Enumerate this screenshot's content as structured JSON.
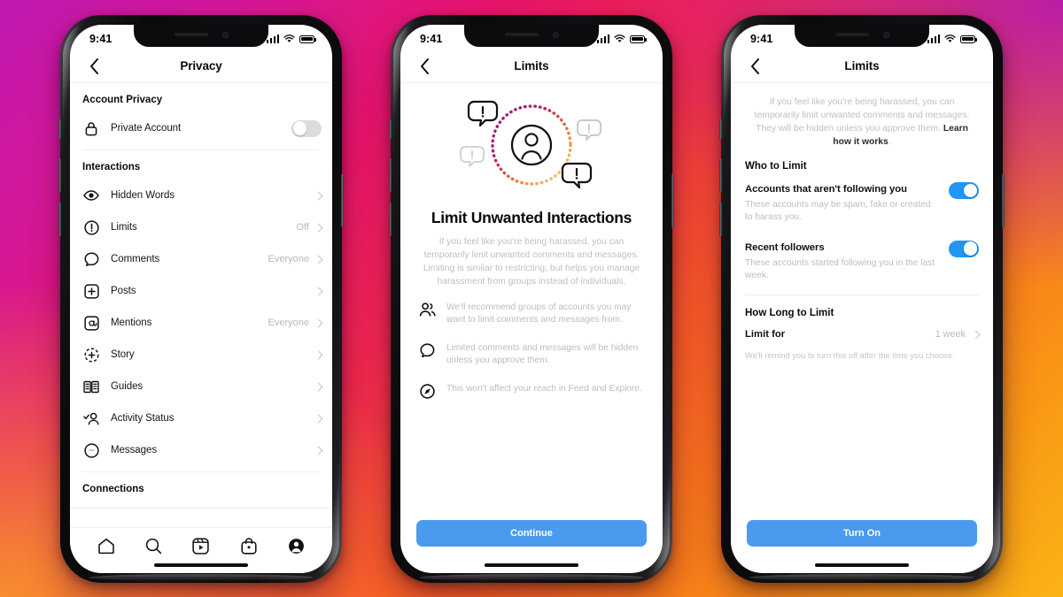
{
  "background": {
    "gradient_from": "#c018b0",
    "gradient_mid": "#ea1a63",
    "gradient_to": "#fbb315"
  },
  "accent": {
    "blue": "#4a9bef",
    "toggle_on": "#2196f3",
    "toggle_off": "#dcdcde"
  },
  "status_bar": {
    "time": "9:41",
    "signal": "cellular-bars-icon",
    "wifi": "wifi-icon",
    "battery": "battery-full-icon"
  },
  "phone1": {
    "nav": {
      "back": "chevron-left-icon",
      "title": "Privacy"
    },
    "sections": [
      {
        "header": "Account Privacy",
        "rows": [
          {
            "icon": "lock-icon",
            "label": "Private Account",
            "value": "",
            "control": "toggle",
            "toggle_on": false
          }
        ]
      },
      {
        "header": "Interactions",
        "rows": [
          {
            "icon": "hidden-words-icon",
            "label": "Hidden Words",
            "value": "",
            "control": "chevron"
          },
          {
            "icon": "limits-icon",
            "label": "Limits",
            "value": "Off",
            "control": "chevron"
          },
          {
            "icon": "comment-icon",
            "label": "Comments",
            "value": "Everyone",
            "control": "chevron"
          },
          {
            "icon": "posts-icon",
            "label": "Posts",
            "value": "",
            "control": "chevron"
          },
          {
            "icon": "mentions-icon",
            "label": "Mentions",
            "value": "Everyone",
            "control": "chevron"
          },
          {
            "icon": "story-icon",
            "label": "Story",
            "value": "",
            "control": "chevron"
          },
          {
            "icon": "guides-icon",
            "label": "Guides",
            "value": "",
            "control": "chevron"
          },
          {
            "icon": "activity-status-icon",
            "label": "Activity Status",
            "value": "",
            "control": "chevron"
          },
          {
            "icon": "messages-icon",
            "label": "Messages",
            "value": "",
            "control": "chevron"
          }
        ]
      },
      {
        "header": "Connections",
        "rows": []
      }
    ],
    "tabbar": [
      "home-icon",
      "search-icon",
      "reels-icon",
      "shop-icon",
      "profile-icon"
    ]
  },
  "phone2": {
    "nav": {
      "back": "chevron-left-icon",
      "title": "Limits"
    },
    "illustration": "limit-unwanted-interactions-illustration",
    "title": "Limit Unwanted Interactions",
    "paragraph": "If you feel like you're being harassed, you can temporarily limit unwanted comments and messages. Limiting is similar to restricting, but helps you manage harassment from groups instead of individuals.",
    "bullets": [
      {
        "icon": "group-accounts-icon",
        "text": "We'll recommend groups of accounts you may want to limit comments and messages from."
      },
      {
        "icon": "comment-icon",
        "text": "Limited comments and messages will be hidden unless you approve them."
      },
      {
        "icon": "compass-explore-icon",
        "text": "This won't affect your reach in Feed and Explore."
      }
    ],
    "cta": "Continue"
  },
  "phone3": {
    "nav": {
      "back": "chevron-left-icon",
      "title": "Limits"
    },
    "paragraph_prefix": "If you feel like you're being harassed, you can temporarily limit unwanted comments and messages. They will be hidden unless you approve them. ",
    "paragraph_link": "Learn how it works",
    "paragraph_suffix": ".",
    "section_who": "Who to Limit",
    "options": [
      {
        "title": "Accounts that aren't following you",
        "subtitle": "These accounts may be spam, fake or created to harass you.",
        "toggle_on": true
      },
      {
        "title": "Recent followers",
        "subtitle": "These accounts started following you in the last week.",
        "toggle_on": true
      }
    ],
    "section_how_long": "How Long to Limit",
    "limit_for": {
      "label": "Limit for",
      "value": "1 week",
      "chevron": "chevron-right-icon"
    },
    "note": "We'll remind you to turn this off after the time you choose.",
    "cta": "Turn On"
  }
}
